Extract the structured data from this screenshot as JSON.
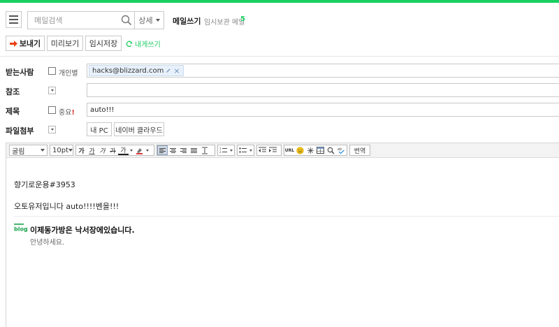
{
  "header": {
    "search_placeholder": "메일검색",
    "detail_label": "상세",
    "write_title": "메일쓰기",
    "drafts_label": "임시보관 메일",
    "drafts_count": "5"
  },
  "actions": {
    "send": "보내기",
    "preview": "미리보기",
    "save_temp": "임시저장",
    "write_to_self": "내게쓰기"
  },
  "form": {
    "recipient_label": "받는사람",
    "individual_label": "개인별",
    "recipient_chip": "hacks@blizzard.com",
    "cc_label": "참조",
    "subject_label": "제목",
    "important_label": "중요",
    "important_mark": "!",
    "subject_value": "auto!!!",
    "attach_label": "파일첨부",
    "my_pc": "내 PC",
    "naver_cloud": "네이버 클라우드"
  },
  "toolbar": {
    "font": "굴림",
    "size": "10pt",
    "bold": "가",
    "underline": "가",
    "italic": "가",
    "strike": "가",
    "font_color": "가",
    "translate": "번역",
    "url": "URL"
  },
  "body": {
    "line1": "향기로운용#3953",
    "line2": "오토유저입니다 auto!!!!벤을!!!"
  },
  "signature": {
    "title": "이제동가방은 낙서장에있습니다.",
    "subtitle": "안녕하세요."
  },
  "colors": {
    "brand_green": "#19ce60",
    "send_arrow": "#e8420f",
    "important": "#e43b3b"
  }
}
